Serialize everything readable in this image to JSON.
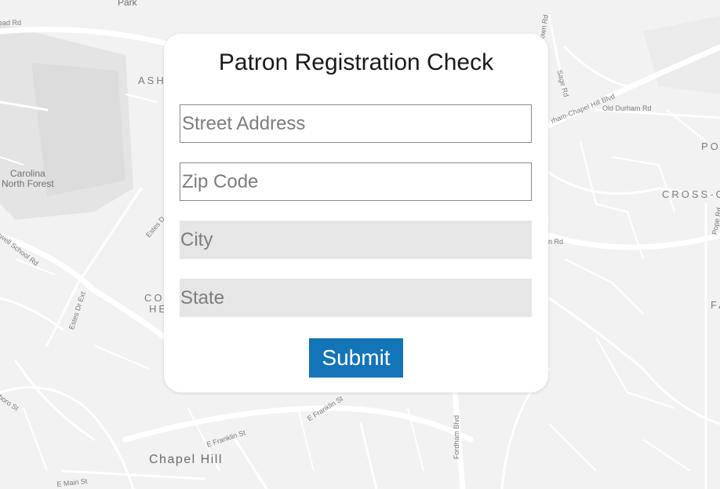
{
  "form": {
    "title": "Patron Registration Check",
    "street_placeholder": "Street Address",
    "zip_placeholder": "Zip Code",
    "city_placeholder": "City",
    "state_placeholder": "State",
    "submit_label": "Submit"
  },
  "map": {
    "labels": {
      "park": "Park",
      "head_rd": "ead Rd",
      "ash": "ASH",
      "carolina_forest": "Carolina\nNorth Forest",
      "seawell_school": "eawell School Rd",
      "estes_dr": "Estes D",
      "estes_dr_ext": "Estes Dr Ext",
      "co": "CO",
      "he": "HE",
      "boro_st": "sboro St",
      "chapel_hill": "Chapel Hill",
      "e_franklin_1": "E Franklin St",
      "e_franklin_2": "E Franklin St",
      "e_main": "E Main St",
      "fordham_blvd": "Fordham Blvd",
      "sage_rd": "Sage Rd",
      "durham_chapel_hill": "rham-Chapel Hill Blvd",
      "old_durham": "Old Durham Rd",
      "own_rd": "own Rd",
      "po": "PO",
      "cross_c": "CROSS-C",
      "pope_rd": "Pope Rd",
      "n_rd": "n Rd",
      "fa": "FA"
    }
  },
  "colors": {
    "accent": "#1474b8",
    "map_background": "#f2f2f2",
    "readonly_field": "#e6e6e6"
  }
}
